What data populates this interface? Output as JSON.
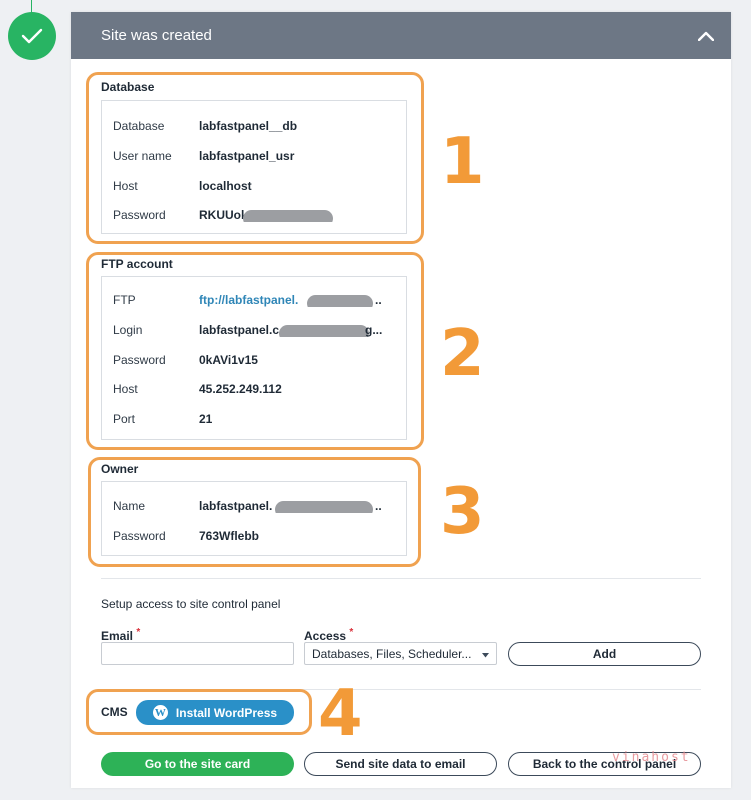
{
  "header": {
    "title": "Site was created"
  },
  "database": {
    "title": "Database",
    "rows": [
      {
        "key": "Database",
        "value": "labfastpanel__db"
      },
      {
        "key": "User name",
        "value": "labfastpanel_usr"
      },
      {
        "key": "Host",
        "value": "localhost"
      },
      {
        "key": "Password",
        "value": "RKUUol"
      }
    ]
  },
  "ftp": {
    "title": "FTP account",
    "rows": [
      {
        "key": "FTP",
        "value": "ftp://labfastpanel."
      },
      {
        "key": "Login",
        "value": "labfastpanel.c"
      },
      {
        "key": "Password",
        "value": "0kAVi1v15"
      },
      {
        "key": "Host",
        "value": "45.252.249.112"
      },
      {
        "key": "Port",
        "value": "21"
      }
    ],
    "ftp_suffix": "..",
    "login_suffix": "g..."
  },
  "owner": {
    "title": "Owner",
    "rows": [
      {
        "key": "Name",
        "value": "labfastpanel."
      },
      {
        "key": "Password",
        "value": "763Wflebb"
      }
    ],
    "name_suffix": ".."
  },
  "access": {
    "title": "Setup access to site control panel",
    "email_label": "Email",
    "access_label": "Access",
    "required_mark": "*",
    "email_value": "",
    "access_selected": "Databases, Files, Scheduler...",
    "add_label": "Add"
  },
  "cms": {
    "label": "CMS",
    "install_label": "Install WordPress",
    "wp_glyph": "W"
  },
  "footer": {
    "site_card_label": "Go to the site card",
    "send_email_label": "Send site data to email",
    "back_label": "Back to the control panel"
  },
  "annotations": [
    "1",
    "2",
    "3",
    "4"
  ],
  "watermark": "vinahost",
  "colors": {
    "accent_green": "#2db257",
    "header_gray": "#6d7785",
    "highlight_orange": "#f0a250",
    "link_blue": "#2f86b7",
    "wp_blue": "#2a90c8"
  }
}
